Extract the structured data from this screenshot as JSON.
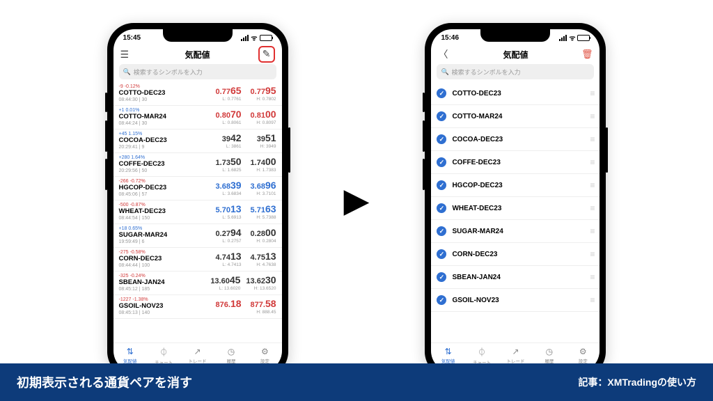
{
  "phone_left": {
    "time": "15:45",
    "title": "気配値",
    "search_placeholder": "検索するシンボルを入力",
    "rows": [
      {
        "chg": "-9 -0.12%",
        "dir": "down",
        "sym": "COTTO-DEC23",
        "time": "08:44:30 | 30",
        "bid": "0.77",
        "bid_big": "65",
        "bid_sub": "L: 0.7761",
        "ask": "0.77",
        "ask_big": "95",
        "ask_sub": "H: 0.7802",
        "pcolor": "down"
      },
      {
        "chg": "+1 0.01%",
        "dir": "up",
        "sym": "COTTO-MAR24",
        "time": "08:44:24 | 30",
        "bid": "0.80",
        "bid_big": "70",
        "bid_sub": "L: 0.8061",
        "ask": "0.81",
        "ask_big": "00",
        "ask_sub": "H: 0.8097",
        "pcolor": "down"
      },
      {
        "chg": "+45 1.15%",
        "dir": "up",
        "sym": "COCOA-DEC23",
        "time": "20:29:41 | 9",
        "bid": "39",
        "bid_big": "42",
        "bid_sub": "L: 3861",
        "ask": "39",
        "ask_big": "51",
        "ask_sub": "H: 3949",
        "pcolor": "neutral"
      },
      {
        "chg": "+280 1.64%",
        "dir": "up",
        "sym": "COFFE-DEC23",
        "time": "20:29:56 | 50",
        "bid": "1.73",
        "bid_big": "50",
        "bid_sub": "L: 1.6825",
        "ask": "1.74",
        "ask_big": "00",
        "ask_sub": "H: 1.7383",
        "pcolor": "neutral"
      },
      {
        "chg": "-266 -0.72%",
        "dir": "down",
        "sym": "HGCOP-DEC23",
        "time": "08:45:06 | 57",
        "bid": "3.68",
        "bid_big": "39",
        "bid_sub": "L: 3.6834",
        "ask": "3.68",
        "ask_big": "96",
        "ask_sub": "H: 3.7101",
        "pcolor": "up"
      },
      {
        "chg": "-500 -0.87%",
        "dir": "down",
        "sym": "WHEAT-DEC23",
        "time": "08:44:54 | 150",
        "bid": "5.70",
        "bid_big": "13",
        "bid_sub": "L: 5.6913",
        "ask": "5.71",
        "ask_big": "63",
        "ask_sub": "H: 5.7388",
        "pcolor": "up"
      },
      {
        "chg": "+18 0.65%",
        "dir": "up",
        "sym": "SUGAR-MAR24",
        "time": "19:59:49 | 6",
        "bid": "0.27",
        "bid_big": "94",
        "bid_sub": "L: 0.2757",
        "ask": "0.28",
        "ask_big": "00",
        "ask_sub": "H: 0.2804",
        "pcolor": "neutral"
      },
      {
        "chg": "-275 -0.58%",
        "dir": "down",
        "sym": "CORN-DEC23",
        "time": "08:44:44 | 100",
        "bid": "4.74",
        "bid_big": "13",
        "bid_sub": "L: 4.7413",
        "ask": "4.75",
        "ask_big": "13",
        "ask_sub": "H: 4.7638",
        "pcolor": "neutral"
      },
      {
        "chg": "-325 -0.24%",
        "dir": "down",
        "sym": "SBEAN-JAN24",
        "time": "08:45:12 | 185",
        "bid": "13.60",
        "bid_big": "45",
        "bid_sub": "L: 13.6020",
        "ask": "13.62",
        "ask_big": "30",
        "ask_sub": "H: 13.6520",
        "pcolor": "neutral"
      },
      {
        "chg": "-1227 -1.38%",
        "dir": "down",
        "sym": "GSOIL-NOV23",
        "time": "08:45:13 | 140",
        "bid": "876.",
        "bid_big": "18",
        "bid_sub": "",
        "ask": "877.",
        "ask_big": "58",
        "ask_sub": "H: 888.45",
        "pcolor": "down"
      }
    ]
  },
  "phone_right": {
    "time": "15:46",
    "title": "気配値",
    "search_placeholder": "検索するシンボルを入力",
    "symbols": [
      "COTTO-DEC23",
      "COTTO-MAR24",
      "COCOA-DEC23",
      "COFFE-DEC23",
      "HGCOP-DEC23",
      "WHEAT-DEC23",
      "SUGAR-MAR24",
      "CORN-DEC23",
      "SBEAN-JAN24",
      "GSOIL-NOV23"
    ]
  },
  "nav": {
    "items": [
      {
        "icon": "⇅",
        "label": "気配値"
      },
      {
        "icon": "⏀",
        "label": "チャート"
      },
      {
        "icon": "↗",
        "label": "トレード"
      },
      {
        "icon": "◷",
        "label": "履歴"
      },
      {
        "icon": "⚙",
        "label": "設定"
      }
    ]
  },
  "footer": {
    "title": "初期表示される通貨ペアを消す",
    "credit": "記事：XMTradingの使い方"
  }
}
